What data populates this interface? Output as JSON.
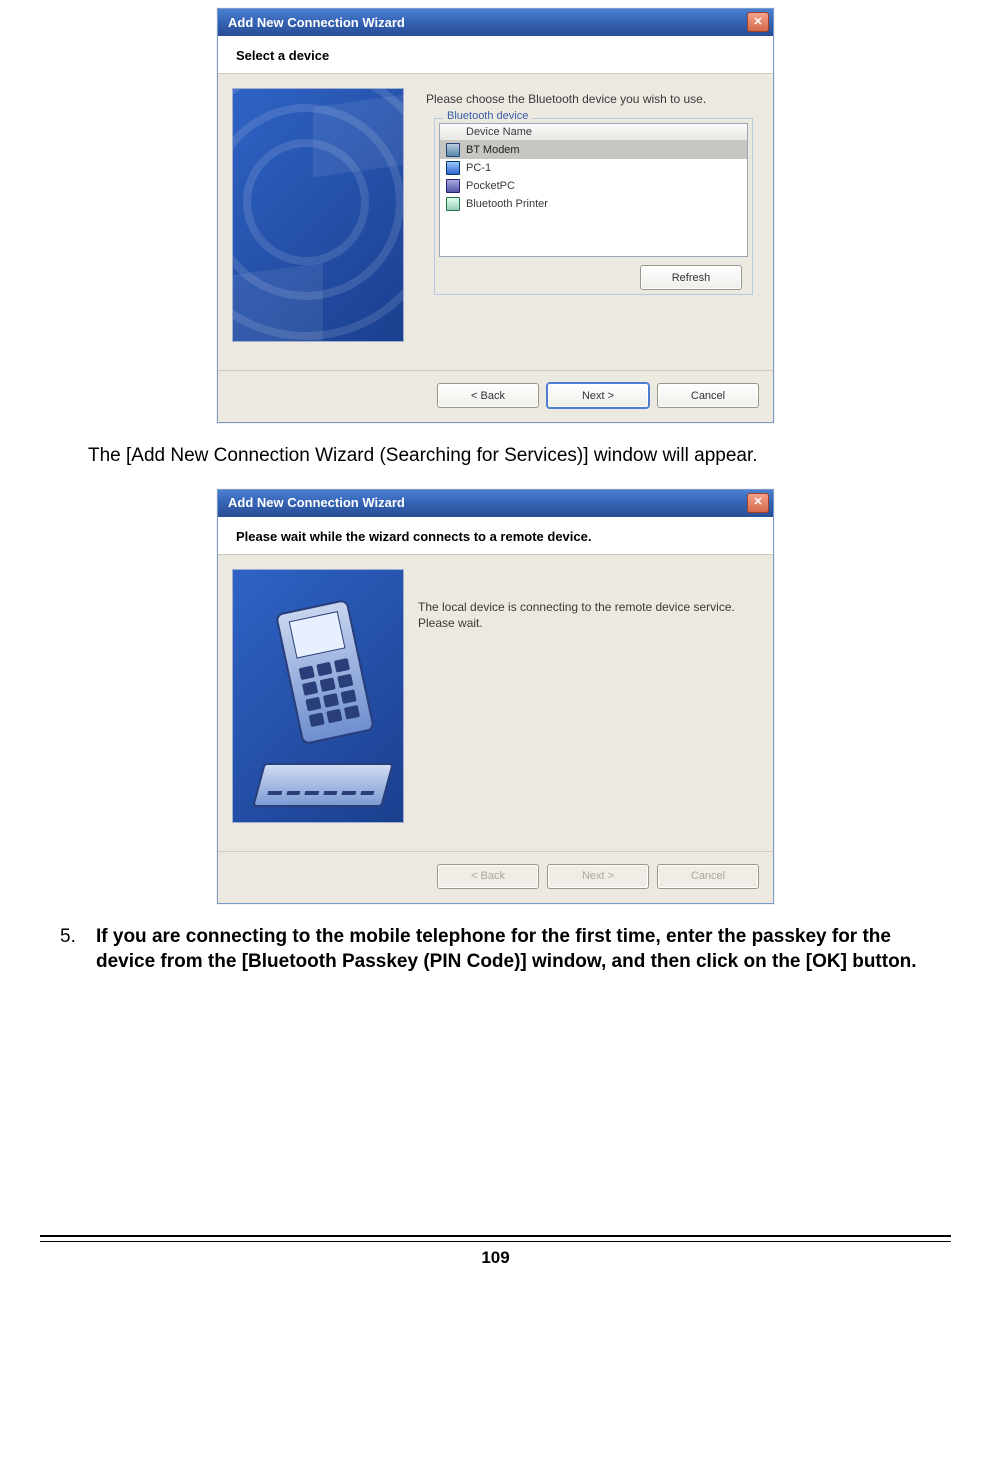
{
  "window1": {
    "title": "Add New Connection Wizard",
    "heading": "Select a device",
    "instruction": "Please choose the Bluetooth device you wish to use.",
    "group_label": "Bluetooth device",
    "column_header": "Device Name",
    "devices": [
      {
        "name": "BT Modem",
        "icon": "phone",
        "selected": true
      },
      {
        "name": "PC-1",
        "icon": "pc",
        "selected": false
      },
      {
        "name": "PocketPC",
        "icon": "pda",
        "selected": false
      },
      {
        "name": "Bluetooth Printer",
        "icon": "printer",
        "selected": false
      }
    ],
    "refresh_label": "Refresh",
    "back_label": "< Back",
    "next_label": "Next >",
    "cancel_label": "Cancel"
  },
  "caption1": "The [Add New Connection Wizard (Searching for Services)] window will appear.",
  "window2": {
    "title": "Add New Connection Wizard",
    "heading": "Please wait while the wizard connects to a remote device.",
    "status_line1": "The local device is connecting to the remote device service.",
    "status_line2": "Please wait.",
    "back_label": "< Back",
    "next_label": "Next >",
    "cancel_label": "Cancel"
  },
  "step5": {
    "num": "5.",
    "text": "If you are connecting to the mobile telephone for the first time, enter the passkey for the device from the [Bluetooth Passkey (PIN Code)] window, and then click on the [OK] button."
  },
  "page_number": "109"
}
